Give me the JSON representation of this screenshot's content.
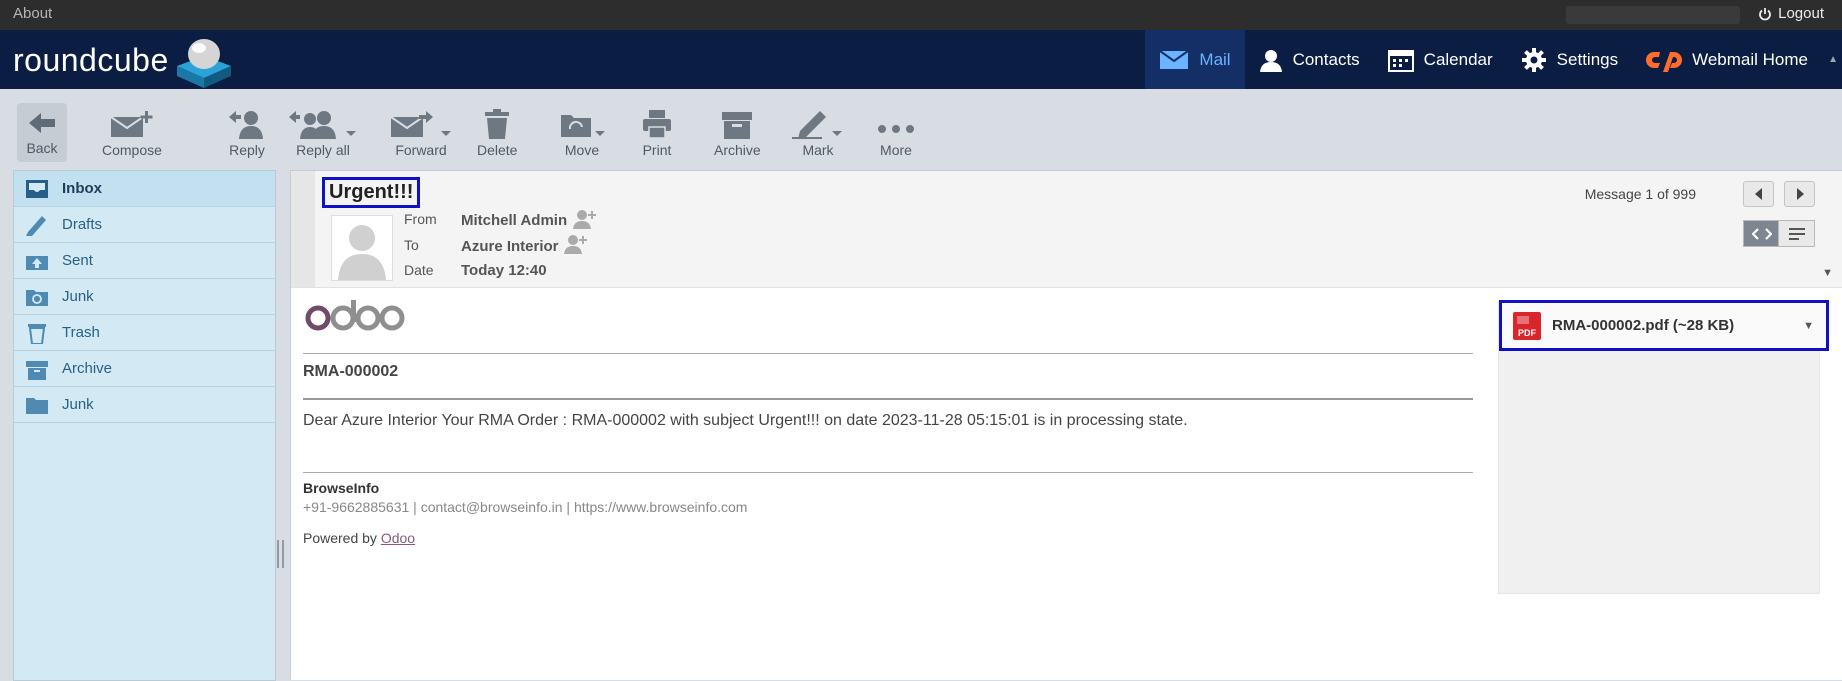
{
  "topbar": {
    "about": "About",
    "logout": "Logout"
  },
  "brand": {
    "logo_text": "roundcube"
  },
  "nav": [
    {
      "label": "Mail",
      "icon": "mail-icon"
    },
    {
      "label": "Contacts",
      "icon": "contacts-icon"
    },
    {
      "label": "Calendar",
      "icon": "calendar-icon"
    },
    {
      "label": "Settings",
      "icon": "gear-icon"
    },
    {
      "label": "Webmail Home",
      "icon": "cpanel-icon"
    }
  ],
  "toolbar": {
    "back": "Back",
    "compose": "Compose",
    "reply": "Reply",
    "reply_all": "Reply all",
    "forward": "Forward",
    "delete": "Delete",
    "move": "Move",
    "print": "Print",
    "archive": "Archive",
    "mark": "Mark",
    "more": "More"
  },
  "folders": [
    {
      "label": "Inbox",
      "icon": "inbox-icon"
    },
    {
      "label": "Drafts",
      "icon": "pencil-icon"
    },
    {
      "label": "Sent",
      "icon": "sent-icon"
    },
    {
      "label": "Junk",
      "icon": "junk-icon"
    },
    {
      "label": "Trash",
      "icon": "trash-icon"
    },
    {
      "label": "Archive",
      "icon": "archive-icon"
    },
    {
      "label": "Junk",
      "icon": "folder-icon"
    }
  ],
  "message": {
    "subject": "Urgent!!!",
    "from_label": "From",
    "from": "Mitchell Admin",
    "to_label": "To",
    "to": "Azure Interior",
    "date_label": "Date",
    "date": "Today 12:40",
    "counter": "Message 1 of 999"
  },
  "body": {
    "title": "RMA-000002",
    "paragraph": "Dear Azure Interior Your RMA Order : RMA-000002 with subject Urgent!!! on date 2023-11-28 05:15:01 is in processing state.",
    "company": "BrowseInfo",
    "contact": "+91-9662885631 | contact@browseinfo.in | https://www.browseinfo.com",
    "powered_by": "Powered by ",
    "powered_link": "Odoo"
  },
  "attachment": {
    "name": "RMA-000002.pdf (~28 KB)"
  },
  "colors": {
    "header_bg": "#0b1d43",
    "accent": "#6cb3ff",
    "highlight_box": "#1010c8",
    "odoo_purple": "#714b67"
  }
}
